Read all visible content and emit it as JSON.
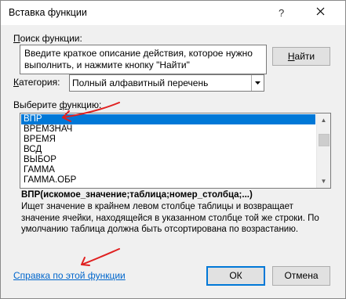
{
  "window": {
    "title": "Вставка функции",
    "help_glyph": "?",
    "close_glyph": "✕"
  },
  "search": {
    "label": "Поиск функции:",
    "text": "Введите краткое описание действия, которое нужно выполнить, и нажмите кнопку \"Найти\"",
    "find_button": "Найти"
  },
  "category": {
    "label": "Категория:",
    "value": "Полный алфавитный перечень"
  },
  "functions": {
    "label": "Выберите функцию:",
    "items": [
      "ВПР",
      "ВРЕМЗНАЧ",
      "ВРЕМЯ",
      "ВСД",
      "ВЫБОР",
      "ГАММА",
      "ГАММА.ОБР"
    ],
    "selected": "ВПР"
  },
  "details": {
    "syntax": "ВПР(искомое_значение;таблица;номер_столбца;...)",
    "description": "Ищет значение в крайнем левом столбце таблицы и возвращает значение ячейки, находящейся в указанном столбце той же строки. По умолчанию таблица должна быть отсортирована по возрастанию."
  },
  "footer": {
    "help_link": "Справка по этой функции",
    "ok_button": "ОК",
    "cancel_button": "Отмена"
  },
  "colors": {
    "selection": "#0078d7",
    "link": "#0066cc",
    "annotation": "#e02020"
  }
}
